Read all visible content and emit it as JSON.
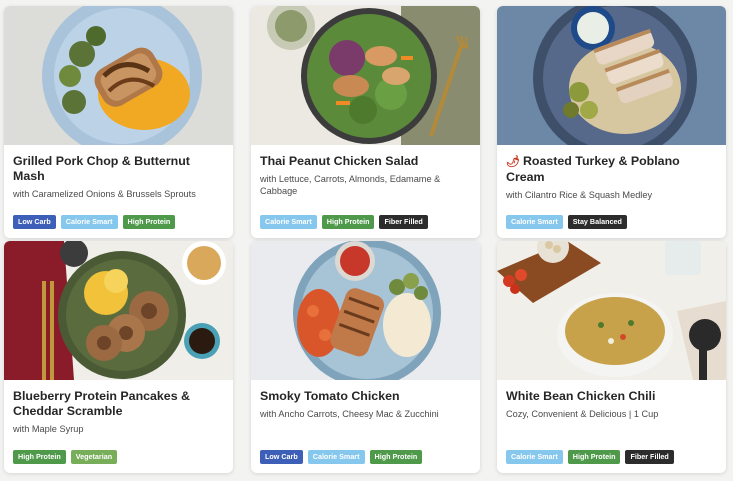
{
  "tag_colors": {
    "Low Carb": "#3e5fb8",
    "Calorie Smart": "#86c7ee",
    "High Protein": "#4e9a4a",
    "Fiber Filled": "#2c2c2c",
    "Stay Balanced": "#2c2c2c",
    "Vegetarian": "#78ad5a"
  },
  "meals": [
    {
      "title": "Grilled Pork Chop & Butternut Mash",
      "subtitle": "with Caramelized Onions & Brussels Sprouts",
      "tags": [
        "Low Carb",
        "Calorie Smart",
        "High Protein"
      ],
      "spicy_icon": ""
    },
    {
      "title": "Thai Peanut Chicken Salad",
      "subtitle": "with Lettuce, Carrots, Almonds, Edamame & Cabbage",
      "tags": [
        "Calorie Smart",
        "High Protein",
        "Fiber Filled"
      ],
      "spicy_icon": ""
    },
    {
      "title": "Roasted Turkey & Poblano Cream",
      "subtitle": "with Cilantro Rice & Squash Medley",
      "tags": [
        "Calorie Smart",
        "Stay Balanced"
      ],
      "spicy_icon": "chili-pepper-icon"
    },
    {
      "title": "Blueberry Protein Pancakes & Cheddar Scramble",
      "subtitle": "with Maple Syrup",
      "tags": [
        "High Protein",
        "Vegetarian"
      ],
      "spicy_icon": ""
    },
    {
      "title": "Smoky Tomato Chicken",
      "subtitle": "with Ancho Carrots, Cheesy Mac & Zucchini",
      "tags": [
        "Low Carb",
        "Calorie Smart",
        "High Protein"
      ],
      "spicy_icon": ""
    },
    {
      "title": "White Bean Chicken Chili",
      "subtitle": "Cozy, Convenient & Delicious | 1 Cup",
      "tags": [
        "Calorie Smart",
        "High Protein",
        "Fiber Filled"
      ],
      "spicy_icon": ""
    }
  ]
}
